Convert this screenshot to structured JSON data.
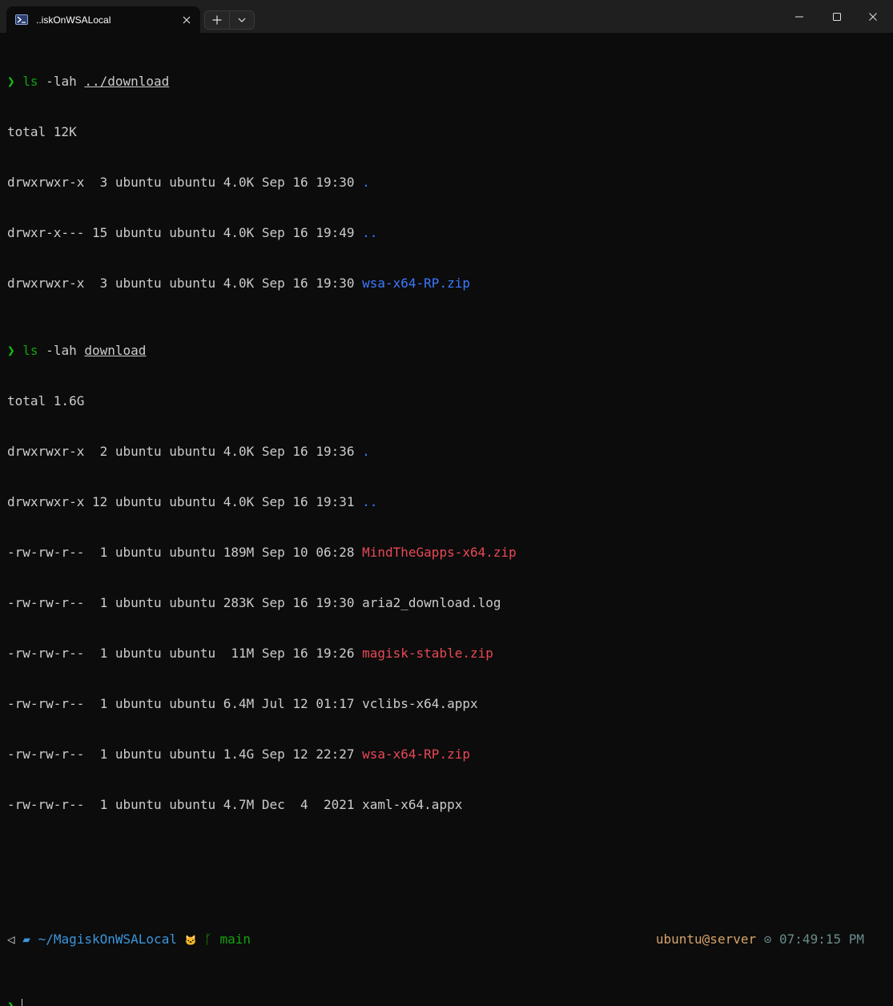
{
  "tab": {
    "title": "..iskOnWSALocal"
  },
  "terminal": {
    "cmd1": {
      "prompt": "❯",
      "command": "ls",
      "args": " -lah ",
      "path": "../download"
    },
    "block1": {
      "total": "total 12K",
      "rows": [
        {
          "meta": "drwxrwxr-x  3 ubuntu ubuntu 4.0K Sep 16 19:30 ",
          "name": "."
        },
        {
          "meta": "drwxr-x--- 15 ubuntu ubuntu 4.0K Sep 16 19:49 ",
          "name": ".."
        },
        {
          "meta": "drwxrwxr-x  3 ubuntu ubuntu 4.0K Sep 16 19:30 ",
          "name": "wsa-x64-RP.zip"
        }
      ]
    },
    "cmd2": {
      "prompt": "❯",
      "command": "ls",
      "args": " -lah ",
      "path": "download"
    },
    "block2": {
      "total": "total 1.6G",
      "rows": [
        {
          "meta": "drwxrwxr-x  2 ubuntu ubuntu 4.0K Sep 16 19:36 ",
          "name": "."
        },
        {
          "meta": "drwxrwxr-x 12 ubuntu ubuntu 4.0K Sep 16 19:31 ",
          "name": ".."
        },
        {
          "meta": "-rw-rw-r--  1 ubuntu ubuntu 189M Sep 10 06:28 ",
          "name": "MindTheGapps-x64.zip"
        },
        {
          "meta": "-rw-rw-r--  1 ubuntu ubuntu 283K Sep 16 19:30 ",
          "name": "aria2_download.log"
        },
        {
          "meta": "-rw-rw-r--  1 ubuntu ubuntu  11M Sep 16 19:26 ",
          "name": "magisk-stable.zip"
        },
        {
          "meta": "-rw-rw-r--  1 ubuntu ubuntu 6.4M Jul 12 01:17 ",
          "name": "vclibs-x64.appx"
        },
        {
          "meta": "-rw-rw-r--  1 ubuntu ubuntu 1.4G Sep 12 22:27 ",
          "name": "wsa-x64-RP.zip"
        },
        {
          "meta": "-rw-rw-r--  1 ubuntu ubuntu 4.7M Dec  4  2021 ",
          "name": "xaml-x64.appx"
        }
      ]
    },
    "status": {
      "os_glyph": "◁",
      "folder_glyph": "▰",
      "cwd": "~/MagiskOnWSALocal",
      "git_glyph": "🐱",
      "branch_glyph": "ᚴ",
      "branch": "main",
      "user_host": "ubuntu@server",
      "clock_glyph": "⊙",
      "time": "07:49:15 PM"
    },
    "cmd3": {
      "prompt": "❯"
    }
  },
  "colors": {
    "titlebar": "#1f1f1f",
    "background": "#0c0c0c",
    "text": "#cccccc",
    "green": "#13a10e",
    "blue": "#3b78ff",
    "red": "#e74856",
    "tan": "#d6a36a"
  },
  "icons": [
    "powershell-icon",
    "close-icon",
    "plus-icon",
    "chevron-down-icon",
    "minimize-icon",
    "maximize-icon",
    "window-close-icon"
  ]
}
